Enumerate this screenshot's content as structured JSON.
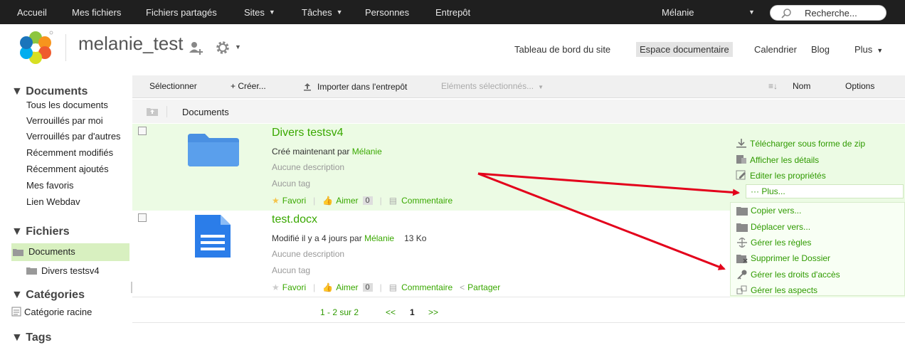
{
  "topbar": {
    "items": [
      {
        "label": "Accueil",
        "caret": false
      },
      {
        "label": "Mes fichiers",
        "caret": false
      },
      {
        "label": "Fichiers partagés",
        "caret": false
      },
      {
        "label": "Sites",
        "caret": true
      },
      {
        "label": "Tâches",
        "caret": true
      },
      {
        "label": "Personnes",
        "caret": false
      },
      {
        "label": "Entrepôt",
        "caret": false
      }
    ],
    "user": "Mélanie",
    "search_placeholder": "Recherche..."
  },
  "header": {
    "site_title": "melanie_test",
    "nav": [
      {
        "label": "Tableau de bord du site",
        "active": false
      },
      {
        "label": "Espace documentaire",
        "active": true
      },
      {
        "label": "Calendrier",
        "active": false
      },
      {
        "label": "Blog",
        "active": false
      },
      {
        "label": "Plus",
        "active": false
      }
    ]
  },
  "sidebar": {
    "documents_heading": "▼ Documents",
    "documents_items": [
      "Tous les documents",
      "Verrouillés par moi",
      "Verrouillés par d'autres",
      "Récemment modifiés",
      "Récemment ajoutés",
      "Mes favoris",
      "Lien Webdav"
    ],
    "files_heading": "▼ Fichiers",
    "files_root": "Documents",
    "files_child": "Divers testsv4",
    "categories_heading": "▼ Catégories",
    "categories_root": "Catégorie racine",
    "tags_heading": "▼ Tags"
  },
  "toolbar": {
    "select": "Sélectionner",
    "create": "+ Créer...",
    "upload": "Importer dans l'entrepôt",
    "selected_items": "Eléments sélectionnés...",
    "sort": "Nom",
    "options": "Options"
  },
  "path": {
    "label": "Documents"
  },
  "rows": [
    {
      "title": "Divers testsv4",
      "meta_prefix": "Créé maintenant par",
      "meta_user": "Mélanie",
      "meta_size": "",
      "description": "Aucune description",
      "tags": "Aucun tag",
      "favorite": "Favori",
      "like": "Aimer",
      "like_count": "0",
      "comment": "Commentaire",
      "share": ""
    },
    {
      "title": "test.docx",
      "meta_prefix": "Modifié il y a 4 jours par",
      "meta_user": "Mélanie",
      "meta_size": "13 Ko",
      "description": "Aucune description",
      "tags": "Aucun tag",
      "favorite": "Favori",
      "like": "Aimer",
      "like_count": "0",
      "comment": "Commentaire",
      "share": "Partager"
    }
  ],
  "actions": {
    "download_zip": "Télécharger sous forme de zip",
    "details": "Afficher les détails",
    "edit_props": "Editer les propriétés",
    "more": "··· Plus...",
    "copy": "Copier vers...",
    "move": "Déplacer vers...",
    "rules": "Gérer les règles",
    "delete": "Supprimer le Dossier",
    "permissions": "Gérer les droits d'accès",
    "aspects": "Gérer les aspects"
  },
  "pagination": {
    "range": "1 - 2 sur 2",
    "prev": "<<",
    "current": "1",
    "next": ">>"
  },
  "colors": {
    "accent": "#39a800",
    "topbar": "#1f1f1f",
    "arrow": "#e3001b",
    "selected_bg": "#ecfbe4"
  }
}
